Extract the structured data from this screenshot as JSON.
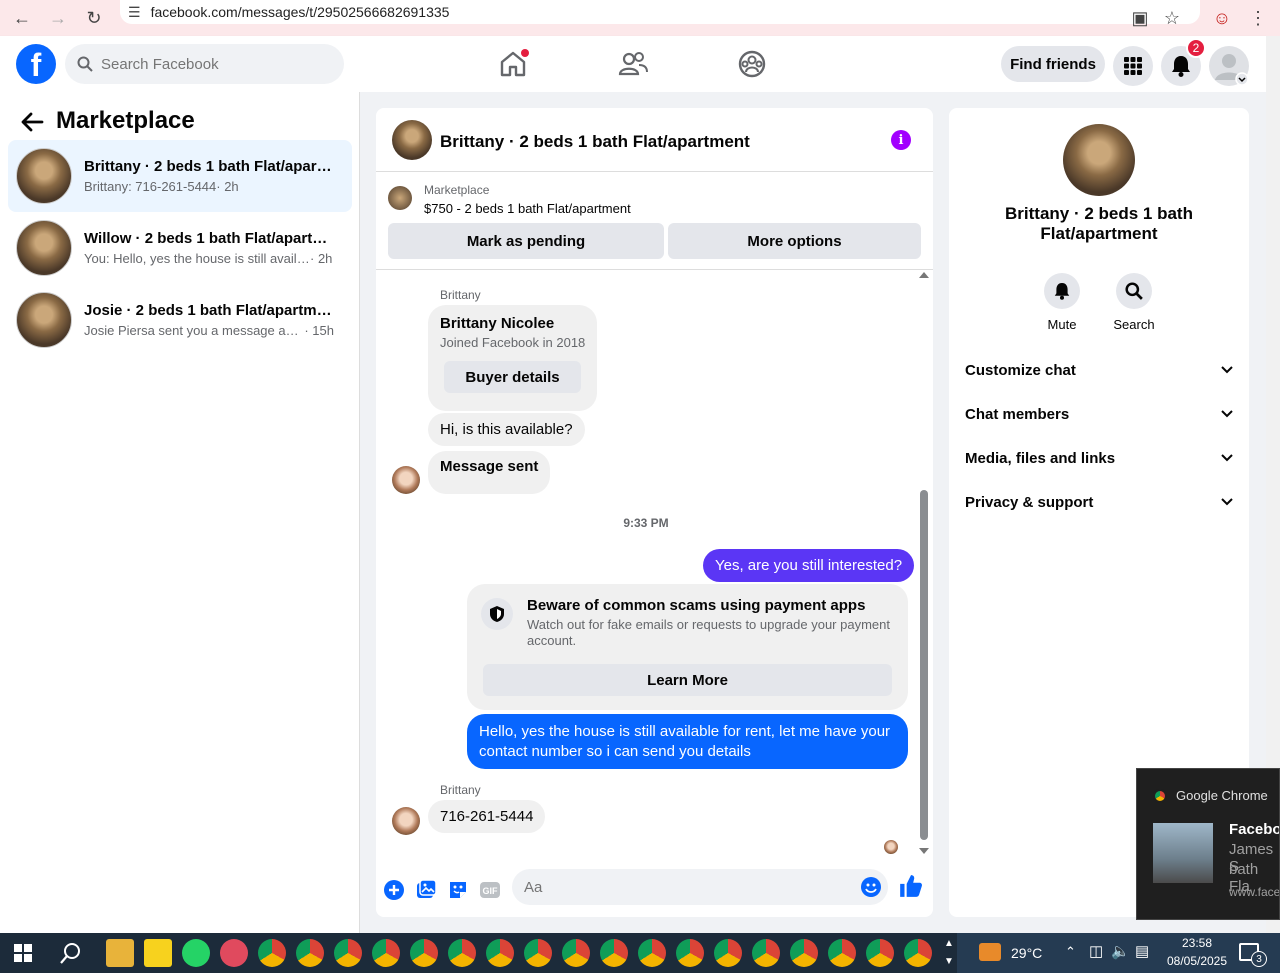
{
  "browser": {
    "url": "facebook.com/messages/t/29502566682691335"
  },
  "topbar": {
    "search_placeholder": "Search Facebook",
    "find_friends": "Find friends",
    "notification_count": "2"
  },
  "sidebar": {
    "title": "Marketplace",
    "conversations": [
      {
        "name": "Brittany · 2 beds 1 bath Flat/apart...",
        "preview": "Brittany: 716-261-5444",
        "time": "· 2h"
      },
      {
        "name": "Willow · 2 beds 1 bath Flat/apartm...",
        "preview": "You: Hello, yes the house is still availa...",
        "time": "· 2h"
      },
      {
        "name": "Josie · 2 beds 1 bath Flat/apartment",
        "preview": "Josie Piersa sent you a message abo...",
        "time": "· 15h"
      }
    ]
  },
  "chat": {
    "title": "Brittany · 2 beds 1 bath Flat/apartment",
    "marketplace_label": "Marketplace",
    "listing": "$750 - 2 beds 1 bath Flat/apartment",
    "mark_pending": "Mark as pending",
    "more_options": "More options",
    "sender1": "Brittany",
    "profile_name": "Brittany Nicolee",
    "profile_joined": "Joined Facebook in 2018",
    "buyer_details": "Buyer details",
    "msg1": "Hi, is this available?",
    "msg2": "Message sent",
    "timestamp": "9:33 PM",
    "msg3": "Yes, are you still interested?",
    "warning_title": "Beware of common scams using payment apps",
    "warning_body": "Watch out for fake emails or requests to upgrade your payment account.",
    "learn_more": "Learn More",
    "msg4": "Hello, yes the house is still available for rent, let me have your contact number so i can send you details",
    "sender2": "Brittany",
    "msg5": "716-261-5444",
    "input_placeholder": "Aa"
  },
  "details": {
    "title": "Brittany · 2 beds 1 bath Flat/apartment",
    "mute": "Mute",
    "search": "Search",
    "sections": [
      "Customize chat",
      "Chat members",
      "Media, files and links",
      "Privacy & support"
    ]
  },
  "toast": {
    "app": "Google Chrome",
    "title": "Faceboo",
    "line1": "James S",
    "line2": "bath Fla",
    "domain": "www.facel"
  },
  "taskbar": {
    "temp": "29°C",
    "time": "23:58",
    "date": "08/05/2025",
    "notif_count": "3"
  },
  "colors": {
    "accent": "#0866ff",
    "outgoing_purple": "#5b36f5",
    "info": "#a200ff",
    "badge": "#e41e3f"
  }
}
